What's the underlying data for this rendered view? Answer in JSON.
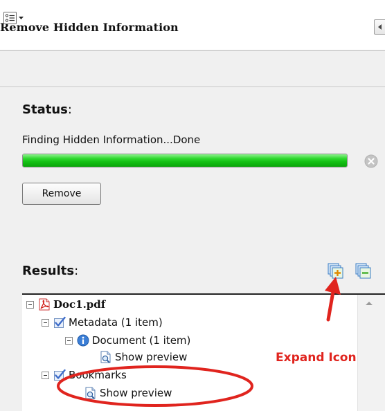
{
  "panel": {
    "title": "Remove Hidden Information"
  },
  "status": {
    "heading": "Status",
    "message": "Finding Hidden Information...Done",
    "progress": 1.0,
    "progress_color": "#14c114",
    "remove_label": "Remove"
  },
  "results": {
    "heading": "Results",
    "tree": [
      {
        "label": "Doc1.pdf",
        "icon": "pdf-icon"
      },
      {
        "label": "Metadata (1 item)",
        "icon": "checkbox-checked-icon"
      },
      {
        "label": "Document (1 item)",
        "icon": "info-icon"
      },
      {
        "label": "Show preview",
        "icon": "preview-icon"
      },
      {
        "label": "Bookmarks",
        "icon": "checkbox-checked-icon"
      },
      {
        "label": "Show preview",
        "icon": "preview-icon"
      }
    ]
  },
  "annotation": {
    "label": "Expand Icon",
    "color": "#e0241e"
  }
}
